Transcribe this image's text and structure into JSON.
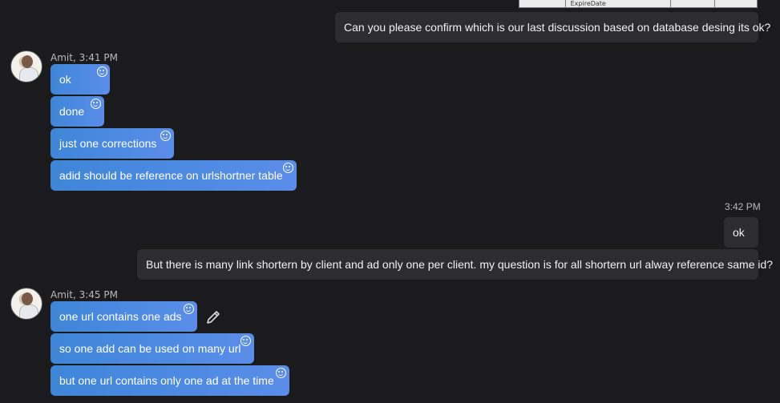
{
  "table_fragment": {
    "column_label": "ExpireDate"
  },
  "messages": [
    {
      "direction": "out",
      "text": "Can you please confirm which is our last discussion based on database desing its ok?"
    },
    {
      "sender": "Amit, 3:41 PM",
      "direction": "in",
      "items": [
        "ok",
        "done",
        "just one corrections",
        "adid should be reference on urlshortner table"
      ]
    },
    {
      "time": "3:42 PM",
      "direction": "out",
      "items": [
        "ok",
        "But there is many link shortern by client and ad only one per client. my question is for all shortern url alway reference same id?"
      ]
    },
    {
      "sender": "Amit, 3:45 PM",
      "direction": "in",
      "items": [
        "one url contains one ads",
        "so one add can be used on many url",
        "but one url contains only one ad at the time"
      ]
    }
  ],
  "icons": {
    "reaction": "smiley-icon",
    "edit": "pencil-icon"
  },
  "colors": {
    "background": "#1b1b1e",
    "incoming_bubble": "#4a8ae0",
    "outgoing_bubble": "#2c2c31",
    "meta_text": "#b9b9be"
  }
}
